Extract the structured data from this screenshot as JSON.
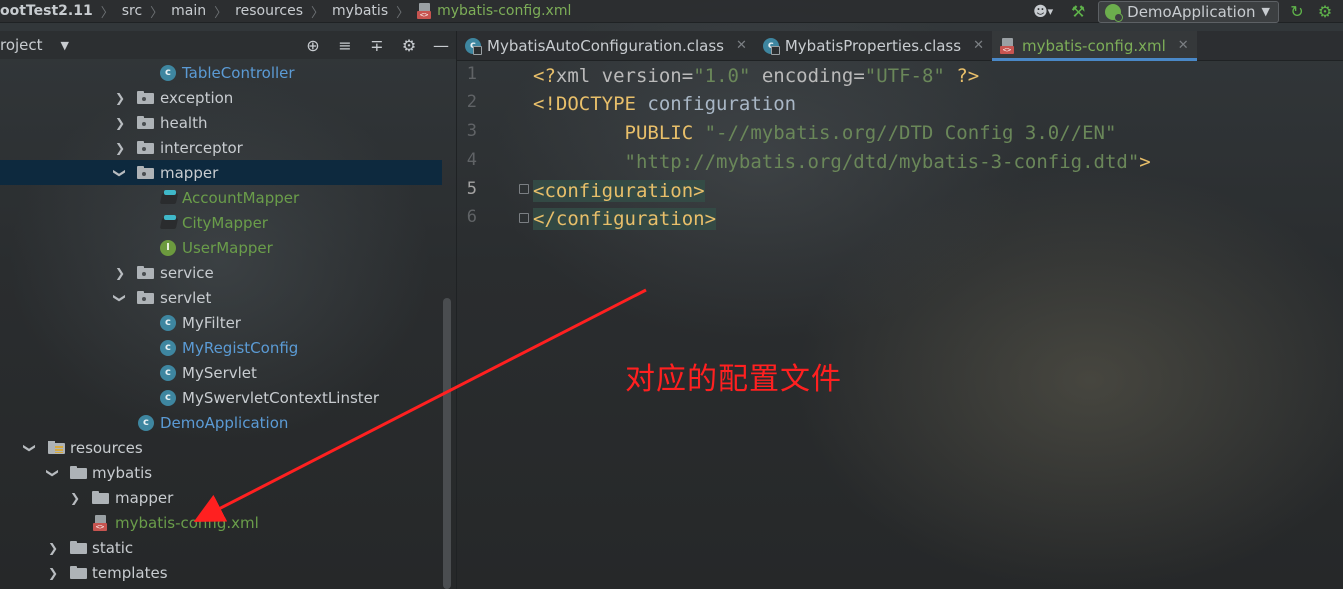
{
  "breadcrumb": {
    "items": [
      "ootTest2.11",
      "src",
      "main",
      "resources",
      "mybatis"
    ],
    "file": "mybatis-config.xml"
  },
  "toolbar": {
    "run_config": "DemoApplication",
    "icons": [
      "user-icon",
      "hammer-icon",
      "spring-icon",
      "rerun-icon",
      "bug-icon"
    ]
  },
  "project_panel": {
    "title": "roject",
    "tools": [
      "locate-icon",
      "expand-all-icon",
      "collapse-all-icon",
      "gear-icon",
      "minimize-icon"
    ]
  },
  "tree": [
    {
      "label": "TableController",
      "type": "class",
      "depth": 3,
      "color": "blue"
    },
    {
      "label": "exception",
      "type": "package",
      "depth": 2,
      "expanded": false
    },
    {
      "label": "health",
      "type": "package",
      "depth": 2,
      "expanded": false
    },
    {
      "label": "interceptor",
      "type": "package",
      "depth": 2,
      "expanded": false
    },
    {
      "label": "mapper",
      "type": "package",
      "depth": 2,
      "expanded": true,
      "selected": true
    },
    {
      "label": "AccountMapper",
      "type": "mapper",
      "depth": 3,
      "color": "green"
    },
    {
      "label": "CityMapper",
      "type": "mapper",
      "depth": 3,
      "color": "green"
    },
    {
      "label": "UserMapper",
      "type": "interface",
      "depth": 3,
      "color": "green"
    },
    {
      "label": "service",
      "type": "package",
      "depth": 2,
      "expanded": false
    },
    {
      "label": "servlet",
      "type": "package",
      "depth": 2,
      "expanded": true
    },
    {
      "label": "MyFilter",
      "type": "class",
      "depth": 3
    },
    {
      "label": "MyRegistConfig",
      "type": "class",
      "depth": 3,
      "color": "blue"
    },
    {
      "label": "MyServlet",
      "type": "class",
      "depth": 3
    },
    {
      "label": "MySwervletContextLinster",
      "type": "class",
      "depth": 3
    },
    {
      "label": "DemoApplication",
      "type": "spring-class",
      "depth": 2,
      "color": "blue"
    },
    {
      "label": "resources",
      "type": "resources",
      "depth": 0,
      "expanded": true
    },
    {
      "label": "mybatis",
      "type": "folder",
      "depth": 1,
      "expanded": true
    },
    {
      "label": "mapper",
      "type": "folder",
      "depth": 2,
      "expanded": false
    },
    {
      "label": "mybatis-config.xml",
      "type": "xml",
      "depth": 2,
      "color": "green"
    },
    {
      "label": "static",
      "type": "folder",
      "depth": 1,
      "expanded": false
    },
    {
      "label": "templates",
      "type": "folder",
      "depth": 1,
      "expanded": false
    }
  ],
  "tabs": [
    {
      "label": "MybatisAutoConfiguration.class",
      "active": false
    },
    {
      "label": "MybatisProperties.class",
      "active": false
    },
    {
      "label": "mybatis-config.xml",
      "active": true
    }
  ],
  "editor": {
    "line_numbers": [
      "1",
      "2",
      "3",
      "4",
      "5",
      "6"
    ],
    "current_line": 5,
    "lines": [
      [
        {
          "t": "<?",
          "c": "punc"
        },
        {
          "t": "xml ",
          "c": "attr"
        },
        {
          "t": "version",
          "c": "attr"
        },
        {
          "t": "=",
          "c": "attr"
        },
        {
          "t": "\"1.0\"",
          "c": "str"
        },
        {
          "t": " encoding",
          "c": "attr"
        },
        {
          "t": "=",
          "c": "attr"
        },
        {
          "t": "\"UTF-8\"",
          "c": "str"
        },
        {
          "t": " ?>",
          "c": "punc"
        }
      ],
      [
        {
          "t": "<!DOCTYPE ",
          "c": "punc"
        },
        {
          "t": "configuration",
          "c": "text"
        }
      ],
      [
        {
          "t": "        ",
          "c": "text"
        },
        {
          "t": "PUBLIC ",
          "c": "punc"
        },
        {
          "t": "\"-//mybatis.org//DTD Config 3.0//EN\"",
          "c": "str"
        }
      ],
      [
        {
          "t": "        ",
          "c": "text"
        },
        {
          "t": "\"http://mybatis.org/dtd/mybatis-3-config.dtd\"",
          "c": "str"
        },
        {
          "t": ">",
          "c": "punc"
        }
      ],
      [
        {
          "t": "<configuration>",
          "c": "tag",
          "hl": true
        }
      ],
      [
        {
          "t": "</configuration>",
          "c": "tag",
          "hl": true
        }
      ]
    ]
  },
  "annotation": {
    "text": "对应的配置文件",
    "color": "#ff2020"
  }
}
